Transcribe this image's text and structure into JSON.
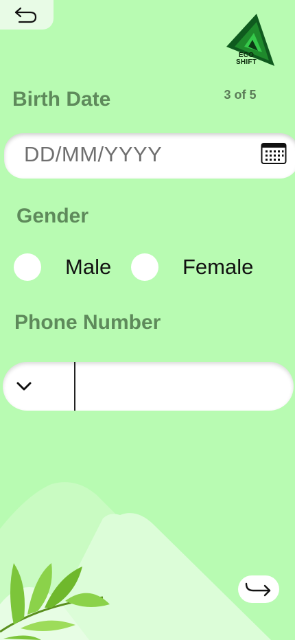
{
  "logo": {
    "line1": "ECO",
    "line2": "SHIFT"
  },
  "step_indicator": "3 of 5",
  "birth_date": {
    "label": "Birth Date",
    "placeholder": "DD/MM/YYYY"
  },
  "gender": {
    "label": "Gender",
    "options": [
      {
        "label": "Male"
      },
      {
        "label": "Female"
      }
    ]
  },
  "phone": {
    "label": "Phone Number",
    "value": ""
  },
  "icons": {
    "back": "back-arrow-icon",
    "calendar": "calendar-icon",
    "dropdown": "chevron-down-icon",
    "next": "forward-arrow-icon"
  },
  "colors": {
    "background": "#b8fbb2",
    "label": "#5e8a5b",
    "field": "#ffffff"
  }
}
